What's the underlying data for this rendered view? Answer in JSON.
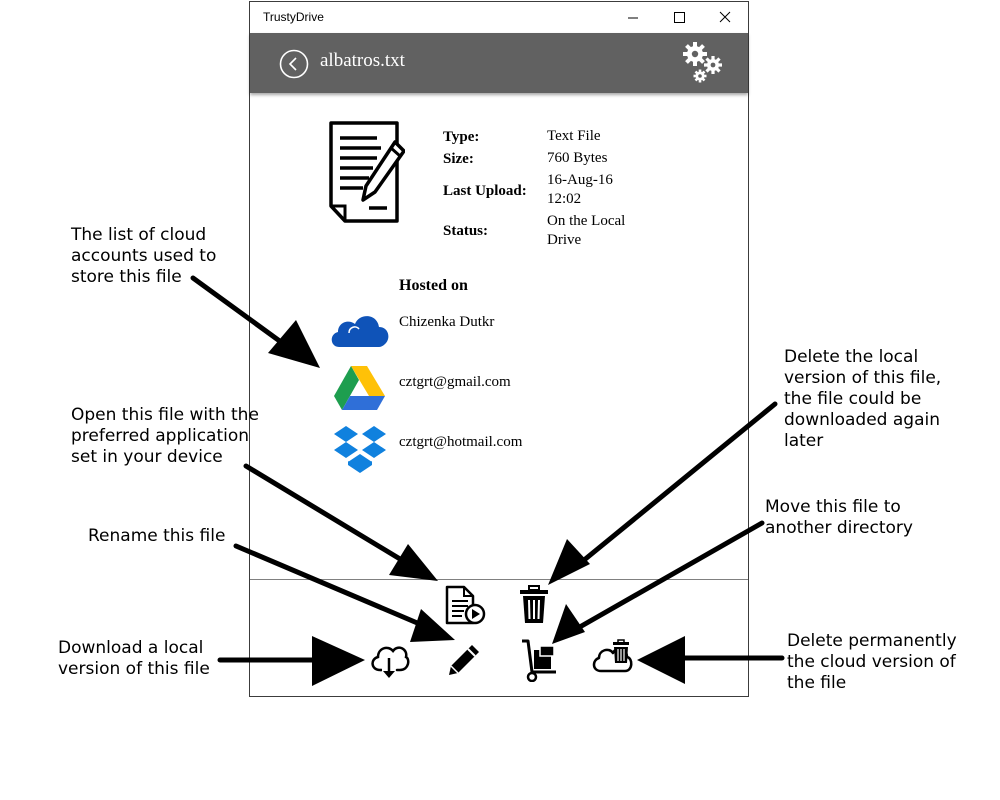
{
  "window": {
    "title": "TrustyDrive"
  },
  "header": {
    "file_name": "albatros.txt"
  },
  "details": {
    "type_label": "Type:",
    "type_value": "Text File",
    "size_label": "Size:",
    "size_value": "760 Bytes",
    "upload_label": "Last Upload:",
    "upload_value_line1": "16-Aug-16",
    "upload_value_line2": "12:02",
    "status_label": "Status:",
    "status_value_line1": "On the Local",
    "status_value_line2": "Drive"
  },
  "hosted": {
    "title": "Hosted on",
    "accounts": [
      {
        "service_icon": "onedrive-icon",
        "name": "Chizenka Dutkr"
      },
      {
        "service_icon": "google-drive-icon",
        "name": "cztgrt@gmail.com"
      },
      {
        "service_icon": "dropbox-icon",
        "name": "cztgrt@hotmail.com"
      }
    ]
  },
  "toolbar_icons": [
    "open-file-icon",
    "trash-icon",
    "cloud-download-icon",
    "pencil-icon",
    "hand-truck-icon",
    "cloud-delete-icon"
  ],
  "annotations": {
    "cloud_accounts": "The list of cloud\naccounts used to\nstore this file",
    "open_file": "Open this file with the\npreferred application\nset in your device",
    "rename": "Rename this file",
    "download": "Download a local\nversion of this file",
    "delete_local": "Delete the local\nversion of this file,\nthe file could be\ndownloaded again\nlater",
    "move": "Move this file to\nanother directory",
    "delete_cloud": "Delete permanently\nthe cloud version of\nthe file"
  },
  "colors": {
    "header_bg": "#616161",
    "onedrive": "#0f53b8",
    "dropbox": "#1081de"
  }
}
